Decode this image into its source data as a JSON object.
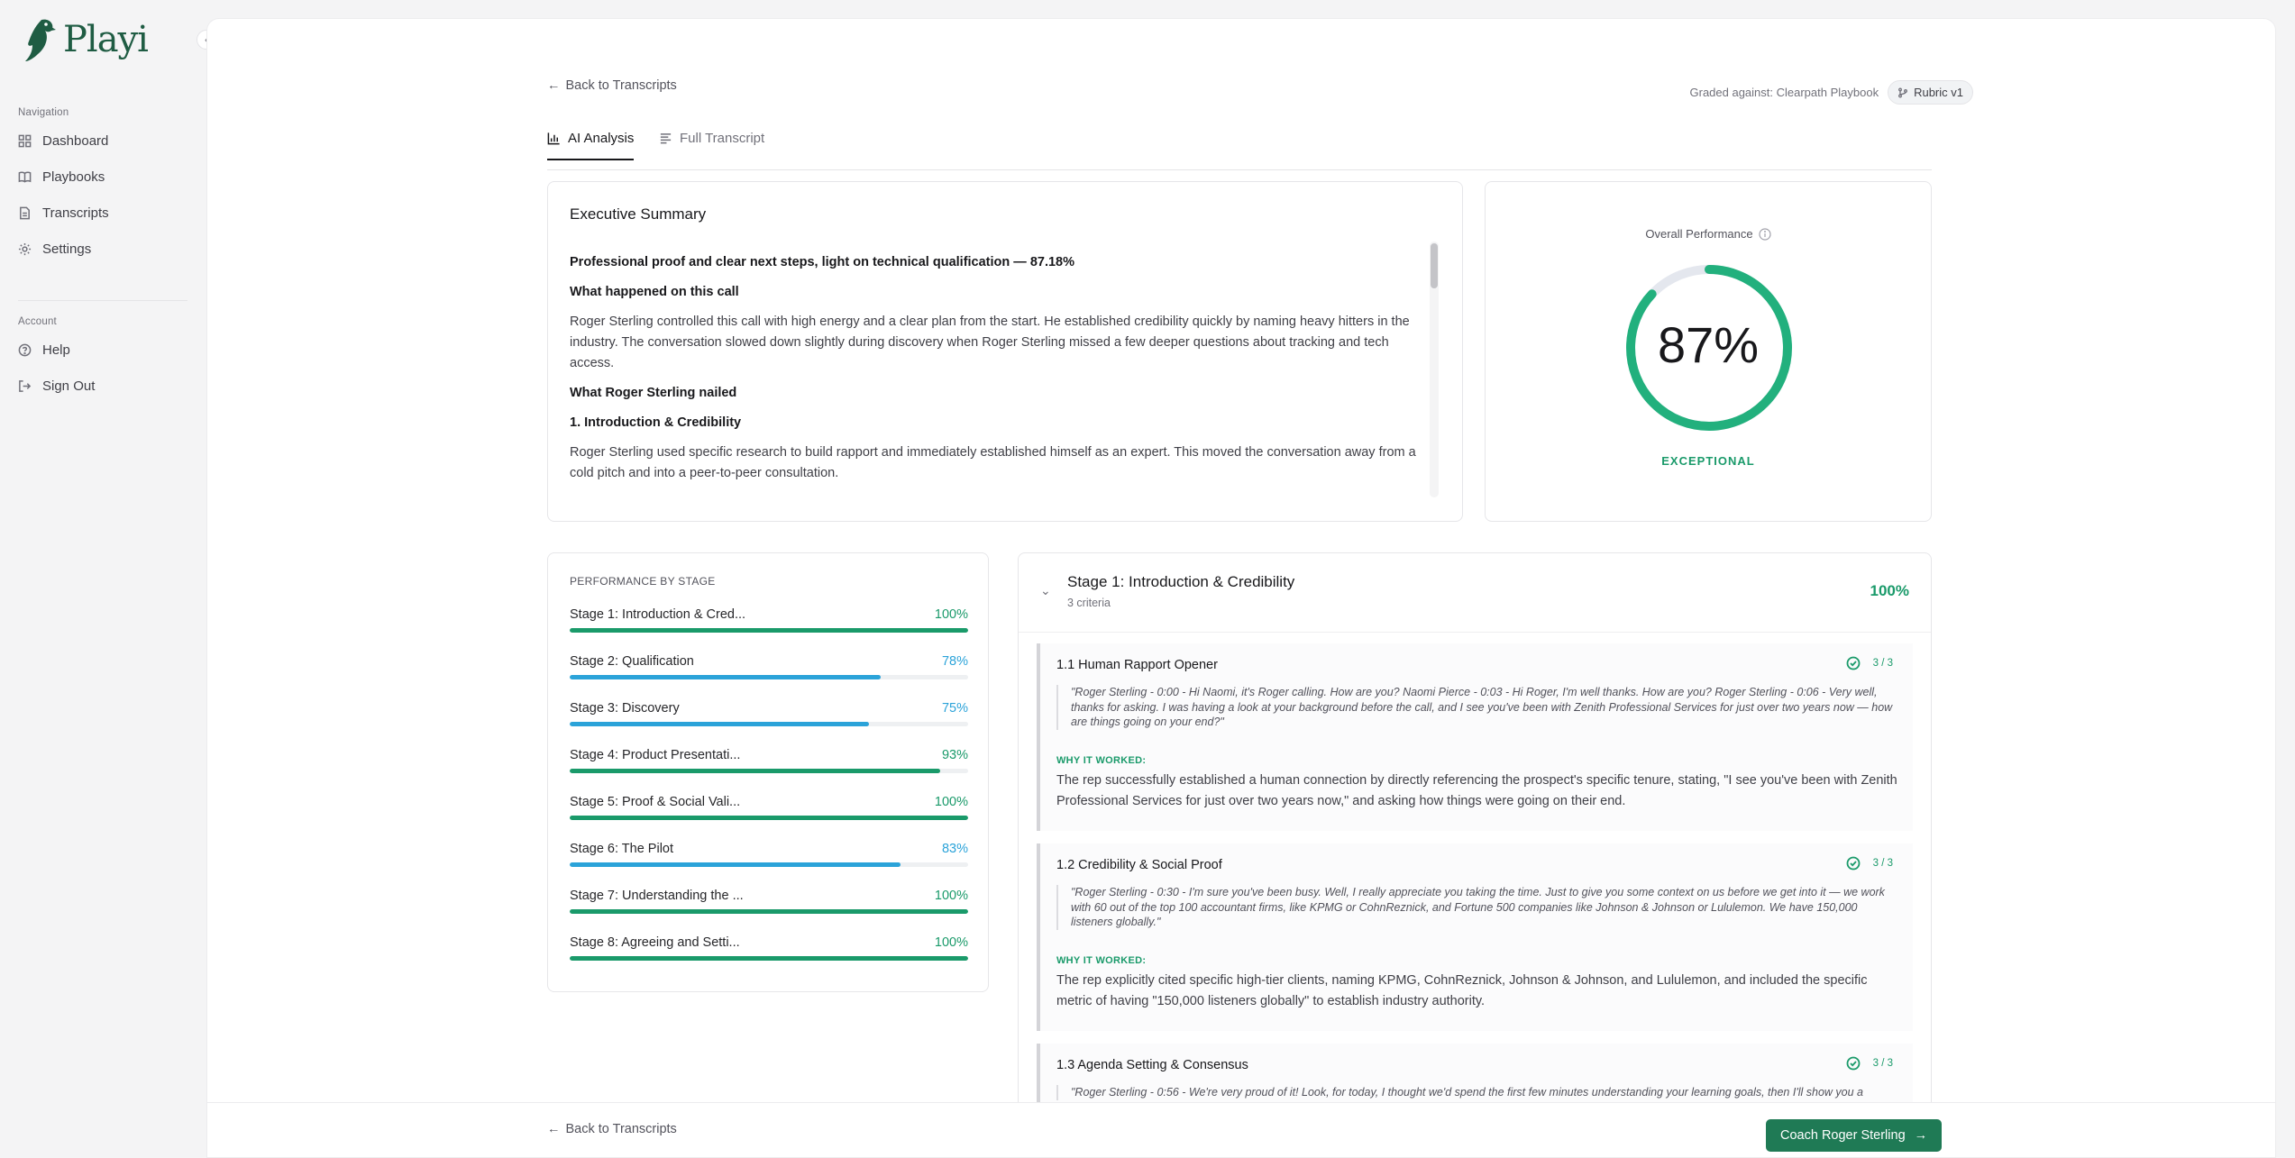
{
  "app": {
    "logo_text": "Playi"
  },
  "sidebar": {
    "nav_label": "Navigation",
    "nav_items": [
      {
        "label": "Dashboard",
        "icon": "dashboard-icon"
      },
      {
        "label": "Playbooks",
        "icon": "book-icon"
      },
      {
        "label": "Transcripts",
        "icon": "file-icon"
      },
      {
        "label": "Settings",
        "icon": "gear-icon"
      }
    ],
    "account_label": "Account",
    "account_items": [
      {
        "label": "Help",
        "icon": "help-icon"
      },
      {
        "label": "Sign Out",
        "icon": "sign-out-icon"
      }
    ]
  },
  "header": {
    "back_label": "Back to Transcripts",
    "graded_against": "Graded against: Clearpath Playbook",
    "rubric_label": "Rubric v1"
  },
  "tabs": [
    {
      "label": "AI Analysis",
      "active": true
    },
    {
      "label": "Full Transcript",
      "active": false
    }
  ],
  "executive_summary": {
    "title": "Executive Summary",
    "headline": "Professional proof and clear next steps, light on technical qualification — 87.18%",
    "section1_title": "What happened on this call",
    "section1_text": "Roger Sterling controlled this call with high energy and a clear plan from the start. He established credibility quickly by naming heavy hitters in the industry. The conversation slowed down slightly during discovery when Roger Sterling missed a few deeper questions about tracking and tech access.",
    "section2_title": "What Roger Sterling nailed",
    "item1_title": "1. Introduction & Credibility",
    "item1_text": "Roger Sterling used specific research to build rapport and immediately established himself as an expert. This moved the conversation away from a cold pitch and into a peer-to-peer consultation."
  },
  "overall": {
    "label": "Overall Performance",
    "value": 87,
    "value_text": "87%",
    "rating": "EXCEPTIONAL",
    "accent": "#22b07d",
    "track": "#e4e7ee"
  },
  "stages": {
    "title": "PERFORMANCE BY STAGE",
    "items": [
      {
        "name": "Stage 1: Introduction & Cred...",
        "pct": 100,
        "pct_text": "100%",
        "color": "#1a9a6a"
      },
      {
        "name": "Stage 2: Qualification",
        "pct": 78,
        "pct_text": "78%",
        "color": "#2ba3d9"
      },
      {
        "name": "Stage 3: Discovery",
        "pct": 75,
        "pct_text": "75%",
        "color": "#2ba3d9"
      },
      {
        "name": "Stage 4: Product Presentati...",
        "pct": 93,
        "pct_text": "93%",
        "color": "#1a9a6a"
      },
      {
        "name": "Stage 5: Proof & Social Vali...",
        "pct": 100,
        "pct_text": "100%",
        "color": "#1a9a6a"
      },
      {
        "name": "Stage 6: The Pilot",
        "pct": 83,
        "pct_text": "83%",
        "color": "#2ba3d9"
      },
      {
        "name": "Stage 7: Understanding the ...",
        "pct": 100,
        "pct_text": "100%",
        "color": "#1a9a6a"
      },
      {
        "name": "Stage 8: Agreeing and Setti...",
        "pct": 100,
        "pct_text": "100%",
        "color": "#1a9a6a"
      }
    ]
  },
  "stage_detail": {
    "title": "Stage 1: Introduction & Credibility",
    "subtitle": "3 criteria",
    "pct_text": "100%",
    "criteria": [
      {
        "title": "1.1 Human Rapport Opener",
        "score": "3 / 3",
        "quote": "\"Roger Sterling - 0:00 - Hi Naomi, it's Roger calling. How are you? Naomi Pierce - 0:03 - Hi Roger, I'm well thanks. How are you? Roger Sterling - 0:06 - Very well, thanks for asking. I was having a look at your background before the call, and I see you've been with Zenith Professional Services for just over two years now — how are things going on your end?\"",
        "why_label": "WHY IT WORKED:",
        "why_text": "The rep successfully established a human connection by directly referencing the prospect's specific tenure, stating, \"I see you've been with Zenith Professional Services for just over two years now,\" and asking how things were going on their end."
      },
      {
        "title": "1.2 Credibility & Social Proof",
        "score": "3 / 3",
        "quote": "\"Roger Sterling - 0:30 - I'm sure you've been busy. Well, I really appreciate you taking the time. Just to give you some context on us before we get into it — we work with 60 out of the top 100 accountant firms, like KPMG or CohnReznick, and Fortune 500 companies like Johnson & Johnson or Lululemon. We have 150,000 listeners globally.\"",
        "why_label": "WHY IT WORKED:",
        "why_text": "The rep explicitly cited specific high-tier clients, naming KPMG, CohnReznick, Johnson & Johnson, and Lululemon, and included the specific metric of having \"150,000 listeners globally\" to establish industry authority."
      },
      {
        "title": "1.3 Agenda Setting & Consensus",
        "score": "3 / 3",
        "quote": "\"Roger Sterling - 0:56 - We're very proud of it! Look, for today, I thought we'd spend the first few minutes understanding your learning goals, then I'll show you a"
      }
    ]
  },
  "footer": {
    "back_label": "Back to Transcripts",
    "coach_label": "Coach Roger Sterling"
  }
}
